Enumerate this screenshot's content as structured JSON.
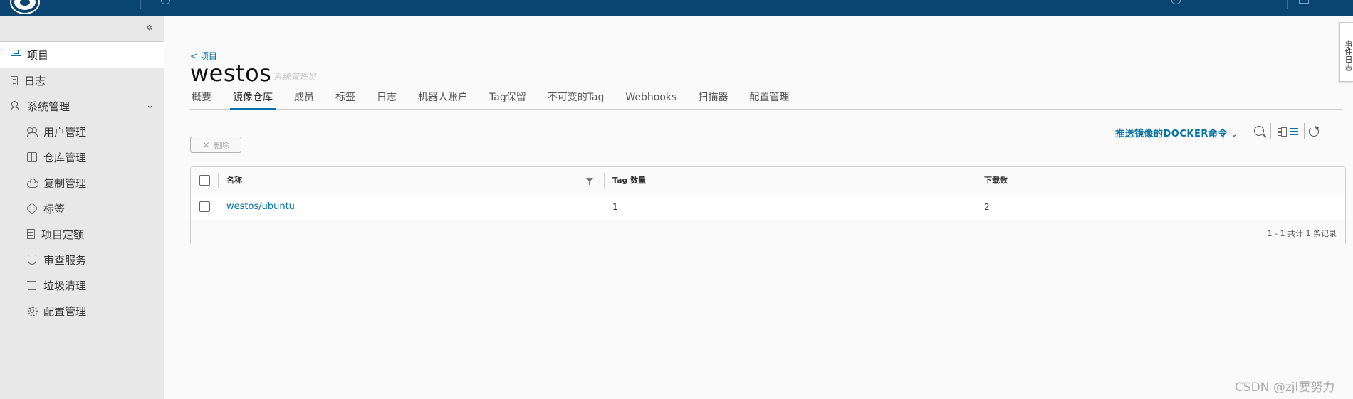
{
  "sidebar": {
    "items": [
      {
        "label": "项目",
        "icon": "project-tree-icon"
      },
      {
        "label": "日志",
        "icon": "log-icon"
      },
      {
        "label": "系统管理",
        "icon": "admin-icon"
      }
    ],
    "sub_items": [
      {
        "label": "用户管理",
        "icon": "users-icon"
      },
      {
        "label": "仓库管理",
        "icon": "registry-box-icon"
      },
      {
        "label": "复制管理",
        "icon": "replication-cloud-icon"
      },
      {
        "label": "标签",
        "icon": "tag-icon"
      },
      {
        "label": "项目定额",
        "icon": "quota-icon"
      },
      {
        "label": "审查服务",
        "icon": "shield-icon"
      },
      {
        "label": "垃圾清理",
        "icon": "trash-icon"
      },
      {
        "label": "配置管理",
        "icon": "gear-icon"
      }
    ]
  },
  "page": {
    "breadcrumb": "< 项目",
    "title": "westos",
    "role": "系统管理员"
  },
  "tabs": [
    "概要",
    "镜像仓库",
    "成员",
    "标签",
    "日志",
    "机器人账户",
    "Tag保留",
    "不可变的Tag",
    "Webhooks",
    "扫描器",
    "配置管理"
  ],
  "active_tab": "镜像仓库",
  "toolbar": {
    "delete_label": "删除",
    "push_command_label": "推送镜像的DOCKER命令"
  },
  "table": {
    "columns": [
      "名称",
      "Tag 数量",
      "下载数"
    ],
    "rows": [
      {
        "name": "westos/ubuntu",
        "tag_count": "1",
        "downloads": "2"
      }
    ],
    "footer": "1 - 1 共计 1 条记录"
  },
  "side_tab": "事件日志",
  "watermark": "CSDN @zjl要努力",
  "colors": {
    "header": "#0a4471",
    "accent": "#0072a3",
    "sidebar_bg": "#e8e8e8"
  }
}
